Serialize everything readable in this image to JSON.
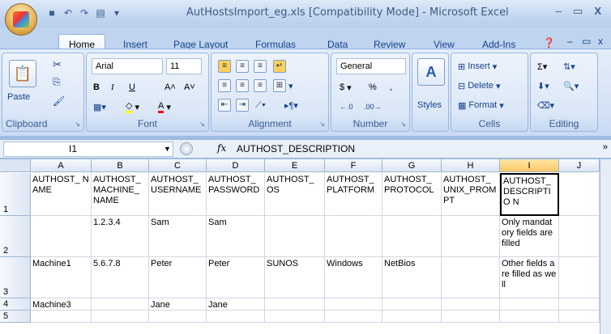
{
  "window": {
    "title": "AutHostsImport_eg.xls  [Compatibility Mode] - Microsoft Excel",
    "min": "–",
    "max": "▭",
    "close": "X"
  },
  "quick_access": {
    "save": "💾",
    "undo": "↶",
    "redo": "↷",
    "print": "🖶"
  },
  "tabs": [
    "Home",
    "Insert",
    "Page Layout",
    "Formulas",
    "Data",
    "Review",
    "View",
    "Add-Ins"
  ],
  "ribbon": {
    "clipboard": {
      "label": "Clipboard",
      "paste": "Paste"
    },
    "font": {
      "label": "Font",
      "name": "Arial",
      "size": "11"
    },
    "alignment": {
      "label": "Alignment"
    },
    "number": {
      "label": "Number",
      "format": "General",
      "currency": "$",
      "percent": "%",
      "comma": ","
    },
    "styles": {
      "label": "Styles"
    },
    "cells": {
      "label": "Cells",
      "insert": "Insert",
      "delete": "Delete",
      "format": "Format"
    },
    "editing": {
      "label": "Editing"
    }
  },
  "formula_bar": {
    "name_box": "I1",
    "fx": "fx",
    "value": "AUTHOST_DESCRIPTION"
  },
  "sheet": {
    "columns": [
      "A",
      "B",
      "C",
      "D",
      "E",
      "F",
      "G",
      "H",
      "I",
      "J"
    ],
    "rows": [
      "1",
      "2",
      "3",
      "4",
      "5"
    ],
    "cells": {
      "r1": [
        "AUTHOST_ NAME",
        "AUTHOST_ MACHINE_ NAME",
        "AUTHOST_ USERNAME",
        "AUTHOST_ PASSWORD",
        "AUTHOST_ OS",
        "AUTHOST_ PLATFORM",
        "AUTHOST_ PROTOCOL",
        "AUTHOST_ UNIX_PROM PT",
        "AUTHOST_ DESCRIPTIO N",
        ""
      ],
      "r2": [
        "",
        "1.2.3.4",
        "Sam",
        "Sam",
        "",
        "",
        "",
        "",
        "Only mandatory fields are filled",
        ""
      ],
      "r3": [
        "Machine1",
        "5.6.7.8",
        "Peter",
        "Peter",
        "SUNOS",
        "Windows",
        "NetBios",
        "",
        "Other fields are filled as well",
        ""
      ],
      "r4": [
        "Machine3",
        "",
        "Jane",
        "Jane",
        "",
        "",
        "",
        "",
        "",
        ""
      ],
      "r5": [
        "",
        "",
        "",
        "",
        "",
        "",
        "",
        "",
        "",
        ""
      ]
    }
  }
}
